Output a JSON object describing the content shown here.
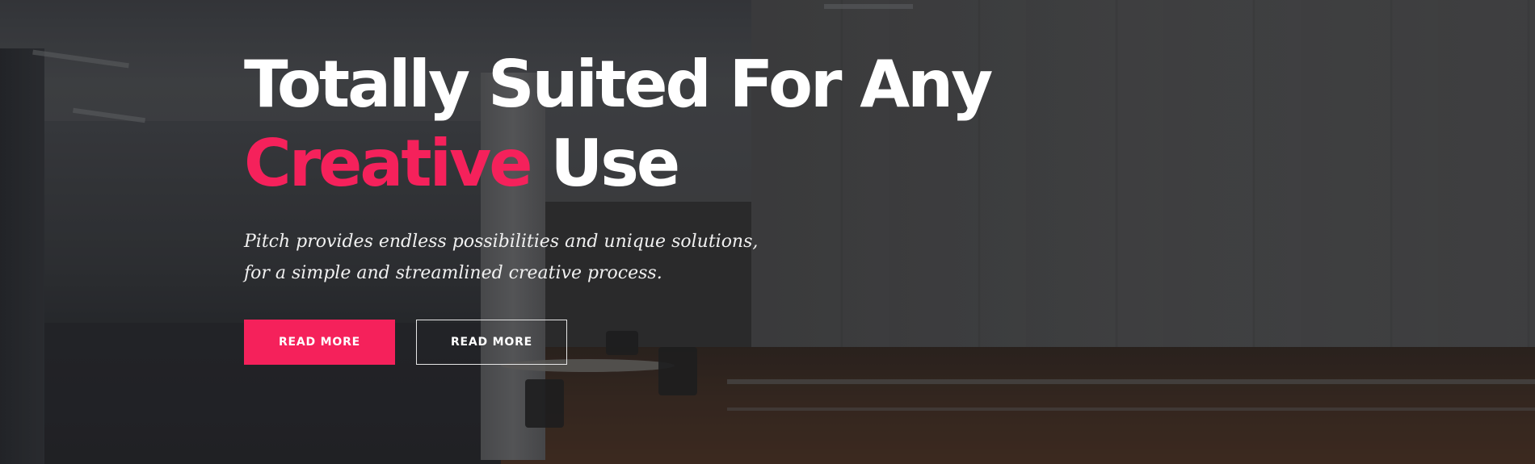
{
  "hero": {
    "title_line1": "Totally Suited For Any",
    "title_accent": "Creative",
    "title_rest": " Use",
    "subtitle_line1": "Pitch provides endless possibilities and unique solutions,",
    "subtitle_line2": "for a simple and streamlined creative process.",
    "buttons": [
      {
        "label": "READ MORE"
      },
      {
        "label": "READ MORE"
      }
    ]
  },
  "colors": {
    "accent": "#f5215b",
    "text": "#ffffff",
    "outline": "#e6e6e6"
  }
}
